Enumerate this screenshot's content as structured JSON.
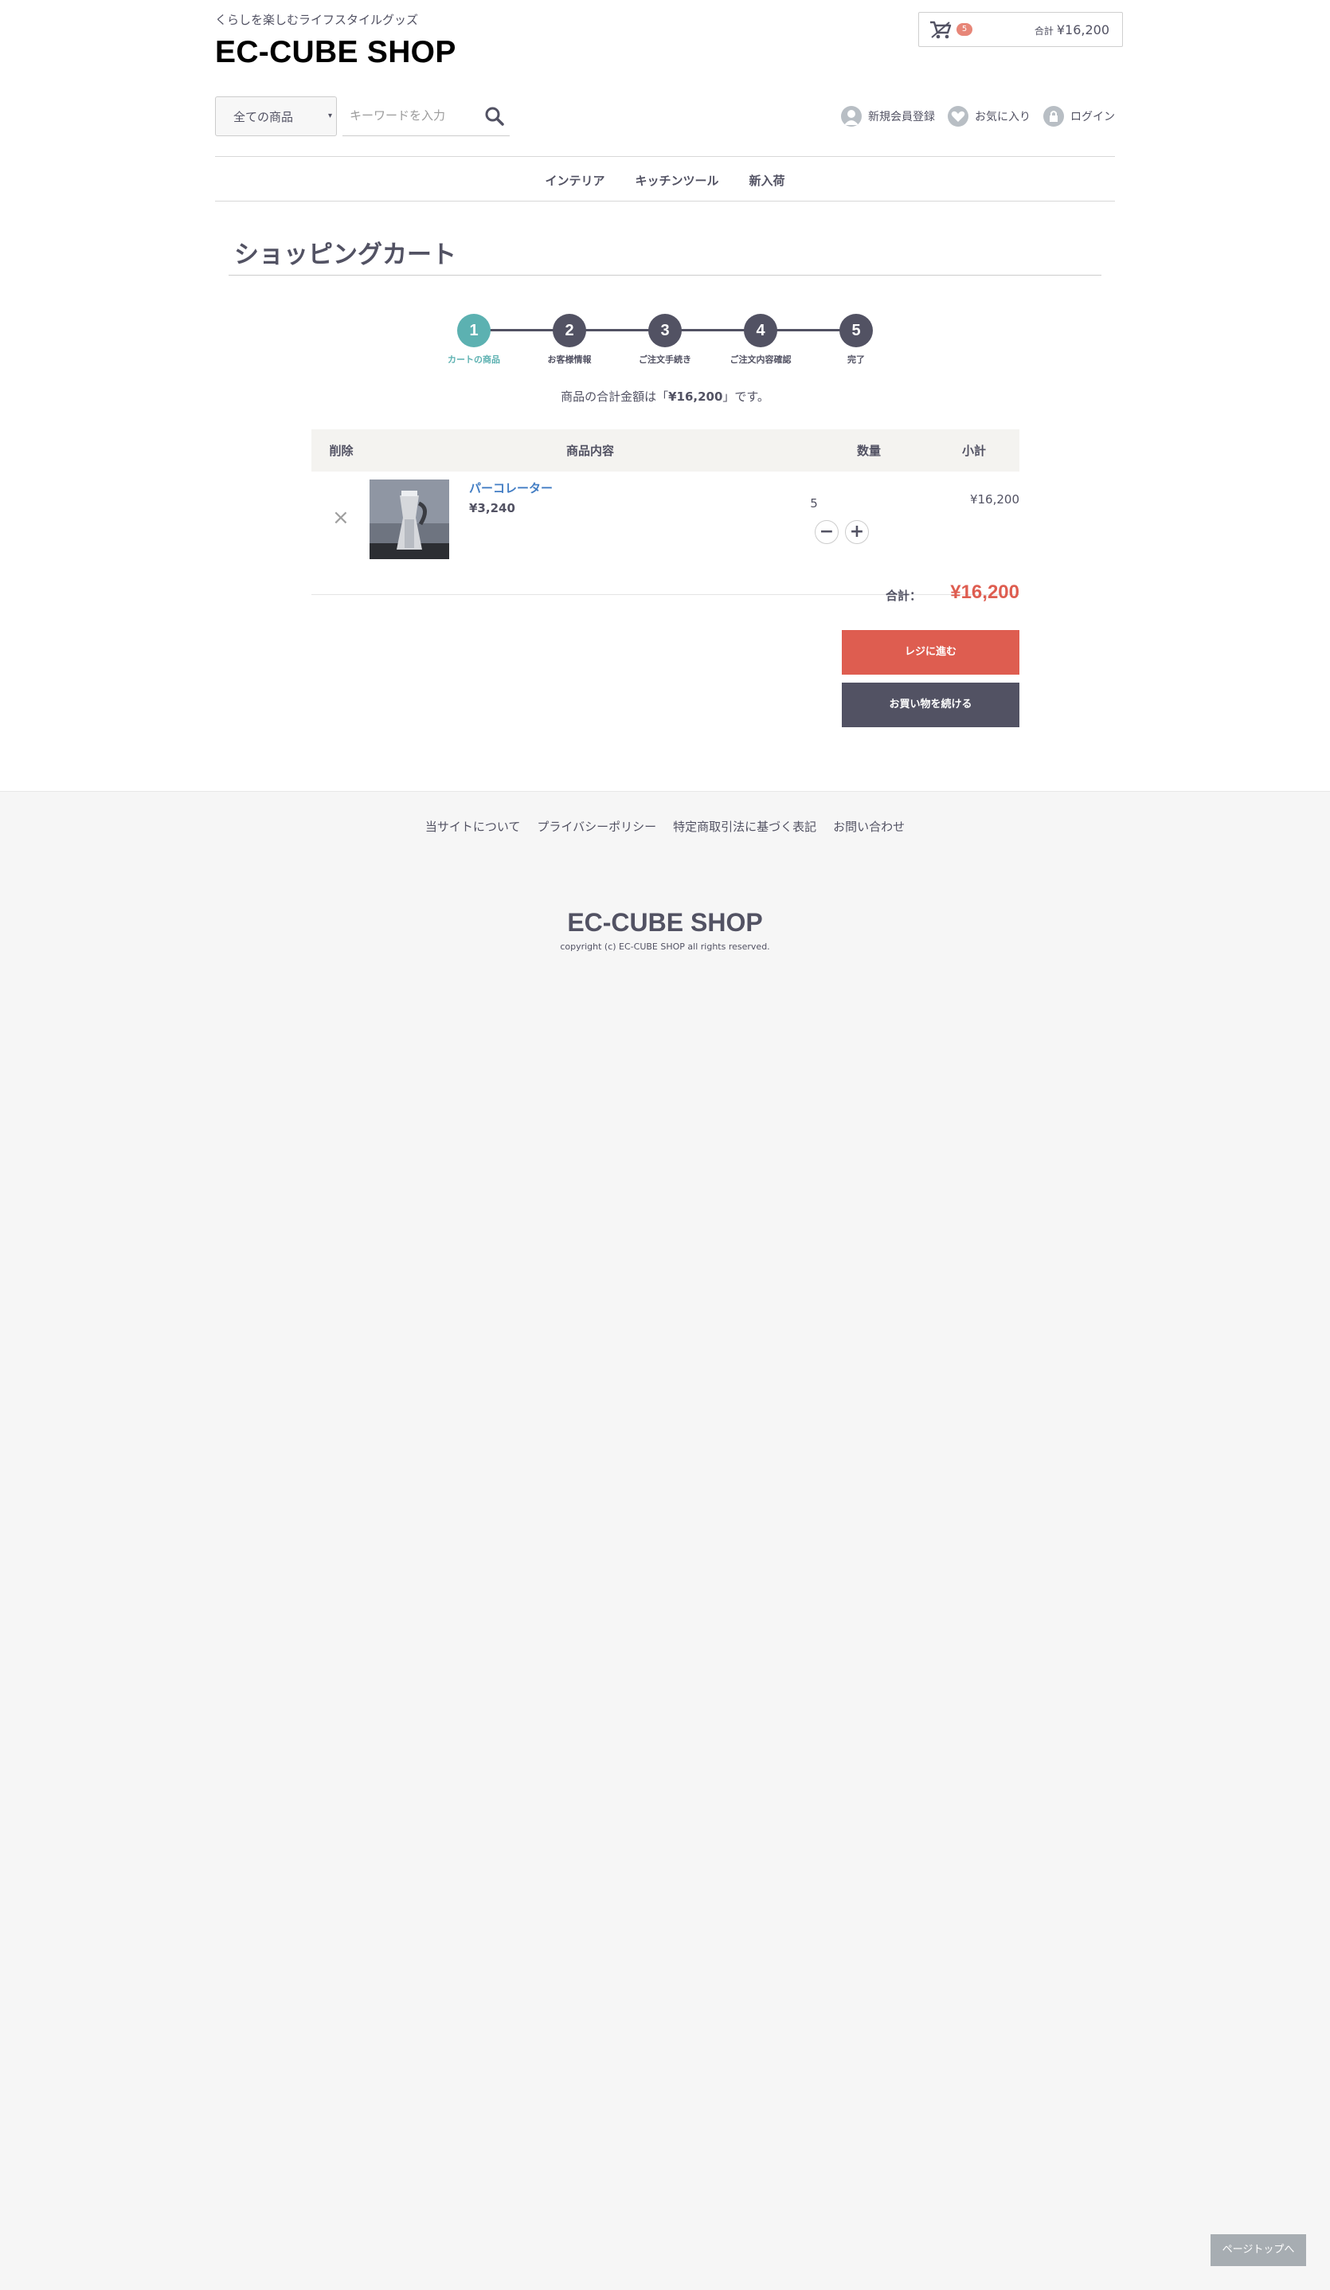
{
  "header": {
    "tagline": "くらしを楽しむライフスタイルグッズ",
    "logo": "EC-CUBE SHOP",
    "cart": {
      "count": "5",
      "total_label": "合計",
      "total": "¥16,200"
    },
    "search": {
      "category": "全ての商品",
      "placeholder": "キーワードを入力"
    },
    "util_nav": {
      "register": "新規会員登録",
      "favorites": "お気に入り",
      "login": "ログイン"
    },
    "gnav": [
      "インテリア",
      "キッチンツール",
      "新入荷"
    ]
  },
  "page": {
    "title": "ショッピングカート",
    "steps": [
      {
        "num": "1",
        "label": "カートの商品",
        "active": true
      },
      {
        "num": "2",
        "label": "お客様情報",
        "active": false
      },
      {
        "num": "3",
        "label": "ご注文手続き",
        "active": false
      },
      {
        "num": "4",
        "label": "ご注文内容確認",
        "active": false
      },
      {
        "num": "5",
        "label": "完了",
        "active": false
      }
    ],
    "total_note_pre": "商品の合計金額は「",
    "total_note_amount": "¥16,200",
    "total_note_post": "」です。"
  },
  "cart_table": {
    "headers": {
      "delete": "削除",
      "item": "商品内容",
      "qty": "数量",
      "subtotal": "小計"
    },
    "rows": [
      {
        "delete_icon": "×",
        "name": "パーコレーター",
        "price": "¥3,240",
        "qty": "5",
        "minus": "−",
        "plus": "+",
        "subtotal": "¥16,200"
      }
    ],
    "sum_label": "合計：",
    "sum_value": "¥16,200"
  },
  "buttons": {
    "checkout": "レジに進む",
    "continue": "お買い物を続ける"
  },
  "footer": {
    "links": [
      "当サイトについて",
      "プライバシーポリシー",
      "特定商取引法に基づく表記",
      "お問い合わせ"
    ],
    "logo": "EC-CUBE SHOP",
    "copyright": "copyright (c) EC-CUBE SHOP all rights reserved."
  },
  "pagetop": "ページトップへ",
  "colors": {
    "accent_teal": "#5cb1b1",
    "accent_red": "#de5d50",
    "dark": "#525263",
    "link_blue": "#437ec4"
  }
}
